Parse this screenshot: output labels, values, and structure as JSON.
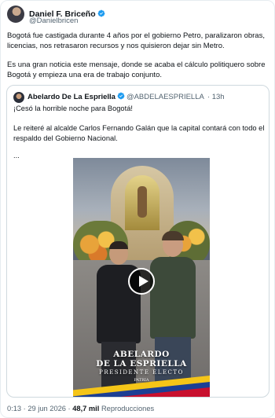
{
  "author": {
    "name": "Daniel F. Briceño",
    "handle": "@Danielbricen"
  },
  "tweet": {
    "paragraph1": "Bogotá fue castigada durante 4 años por el gobierno Petro, paralizaron obras, licencias, nos retrasaron recursos y nos quisieron dejar sin Metro.",
    "paragraph2": "Es una gran noticia este mensaje, donde se acaba el cálculo politiquero sobre Bogotá y empieza una era de trabajo conjunto."
  },
  "quote": {
    "name": "Abelardo De La Espriella",
    "handle": "@ABDELAESPRIELLA",
    "time": "· 13h",
    "line1": "¡Cesó la horrible noche para Bogotá!",
    "line2": "Le reiteré al alcalde Carlos Fernando Galán que la capital contará con todo el respaldo del Gobierno Nacional.",
    "line3": "...",
    "video_caption": {
      "line1": "ABELARDO",
      "line2": "DE LA ESPRIELLA",
      "line3": "PRESIDENTE ELECTO",
      "line4": "PATRIA"
    }
  },
  "footer": {
    "timestamp": "0:13 · 29 jun 2026 ·",
    "views": "48,7 mil",
    "views_label": "Reproducciones"
  },
  "colors": {
    "verified": "#1d9bf0",
    "text": "#0f1419",
    "muted": "#536471",
    "border": "#cfd9de"
  },
  "icons": {
    "verified": "verified-badge-icon",
    "play": "play-icon"
  }
}
